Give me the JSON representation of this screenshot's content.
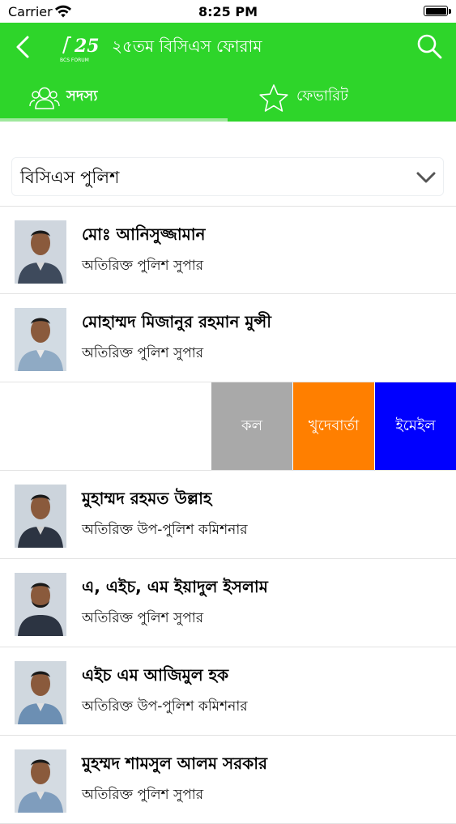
{
  "status_bar": {
    "carrier": "Carrier",
    "time": "8:25 PM"
  },
  "header": {
    "title": "২৫তম বিসিএস ফোরাম",
    "logo_text": "25",
    "logo_sub": "BCS FORUM",
    "back_icon": "chevron-left-icon",
    "search_icon": "search-icon",
    "background": "#2ed52a"
  },
  "tabs": [
    {
      "label": "সদস্য",
      "icon": "members-icon",
      "active": true
    },
    {
      "label": "ফেভারিট",
      "icon": "star-icon",
      "active": false
    }
  ],
  "filter": {
    "selected": "বিসিএস পুলিশ"
  },
  "members": [
    {
      "name": "মোঃ আনিসুজ্জামান",
      "designation": "অতিরিক্ত পুলিশ সুপার"
    },
    {
      "name": "মোহাম্মদ মিজানুর রহমান মুন্সী",
      "designation": "অতিরিক্ত পুলিশ সুপার"
    },
    {
      "swiped": true
    },
    {
      "name": "মুহাম্মদ রহমত উল্লাহ",
      "designation": "অতিরিক্ত উপ-পুলিশ কমিশনার"
    },
    {
      "name": "এ, এইচ, এম ইয়াদুল ইসলাম",
      "designation": "অতিরিক্ত পুলিশ সুপার"
    },
    {
      "name": "এইচ এম আজিমুল হক",
      "designation": "অতিরিক্ত উপ-পুলিশ কমিশনার"
    },
    {
      "name": "মুহম্মদ শামসুল আলম সরকার",
      "designation": "অতিরিক্ত পুলিশ সুপার"
    }
  ],
  "swipe_actions": {
    "call": "কল",
    "sms": "খুদেবার্তা",
    "email": "ইমেইল",
    "colors": {
      "call": "#a9a9a9",
      "sms": "#ff7f00",
      "email": "#0000ff"
    }
  }
}
